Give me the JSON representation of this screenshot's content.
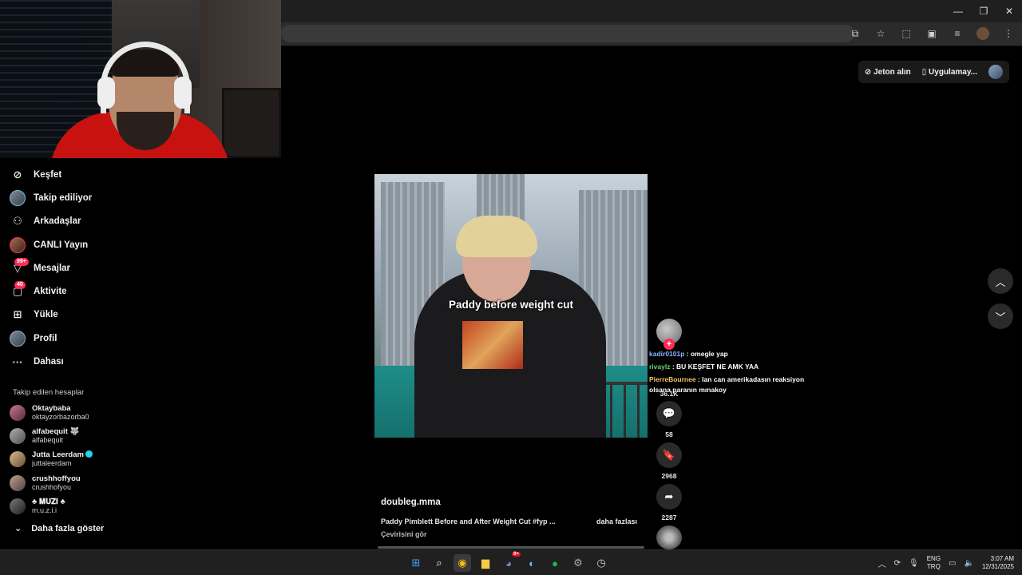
{
  "window": {
    "minimize_icon": "minimize-icon",
    "restore_icon": "restore-icon",
    "close_icon": "close-icon"
  },
  "browser_toolbar": {
    "icons": [
      "install-app-icon",
      "bookmark-star-icon",
      "extensions-icon",
      "tab-search-icon",
      "reading-list-icon",
      "profile-avatar",
      "menu-icon"
    ]
  },
  "top_actions": {
    "coins_label": "Jeton alın",
    "app_label": "Uygulamay..."
  },
  "nav": {
    "items": [
      {
        "label": "Keşfet",
        "icon": "compass-icon"
      },
      {
        "label": "Takip ediliyor",
        "icon": "avatar"
      },
      {
        "label": "Arkadaşlar",
        "icon": "friends-icon"
      },
      {
        "label": "CANLI Yayın",
        "icon": "live-avatar"
      },
      {
        "label": "Mesajlar",
        "icon": "inbox-icon",
        "badge": "99+"
      },
      {
        "label": "Aktivite",
        "icon": "activity-icon",
        "badge": "40"
      },
      {
        "label": "Yükle",
        "icon": "upload-icon"
      },
      {
        "label": "Profil",
        "icon": "profile-avatar"
      },
      {
        "label": "Dahası",
        "icon": "more-dots-icon"
      }
    ]
  },
  "following": {
    "title": "Takip edilen hesaplar",
    "accounts": [
      {
        "name": "Oktaybaba",
        "handle": "oktayzorbazorba0"
      },
      {
        "name": "alfabequit 🐺",
        "handle": "alfabequit"
      },
      {
        "name": "Jutta Leerdam",
        "handle": "juttaleerdam",
        "verified": true
      },
      {
        "name": "crushhoffyou",
        "handle": "crushhofyou"
      },
      {
        "name": "♣ 𝐌𝐔𝐙𝐈 ♣",
        "handle": "m.u.z.i.i"
      }
    ],
    "show_more": "Daha fazla göster"
  },
  "video": {
    "caption": "Paddy before weight cut",
    "author": "doubleg.mma",
    "description": "Paddy Pimblett Before and After Weight Cut #fyp ...",
    "more": "daha fazlası",
    "translate": "Çevirisini gör"
  },
  "actions": {
    "like_count": "36.1K",
    "comment_count": "58",
    "save_count": "2968",
    "share_count": "2287"
  },
  "chat": [
    {
      "user": "kadir0101p",
      "text": "omegle yap"
    },
    {
      "user": "rivaylz",
      "text": "BU KEŞFET NE AMK YAA"
    },
    {
      "user": "PierreBournee",
      "text": "lan can amerikadasın reaksiyon olsana paranın mınakoy"
    }
  ],
  "taskbar": {
    "apps": [
      "windows-start-icon",
      "search-icon",
      "chrome-icon",
      "file-explorer-icon",
      "discord-icon",
      "steam-icon",
      "spotify-icon",
      "settings-icon",
      "clock-app-icon"
    ],
    "discord_badge": "9+",
    "lang_top": "ENG",
    "lang_bottom": "TRQ",
    "time": "3:07 AM",
    "date": "12/31/2025"
  }
}
